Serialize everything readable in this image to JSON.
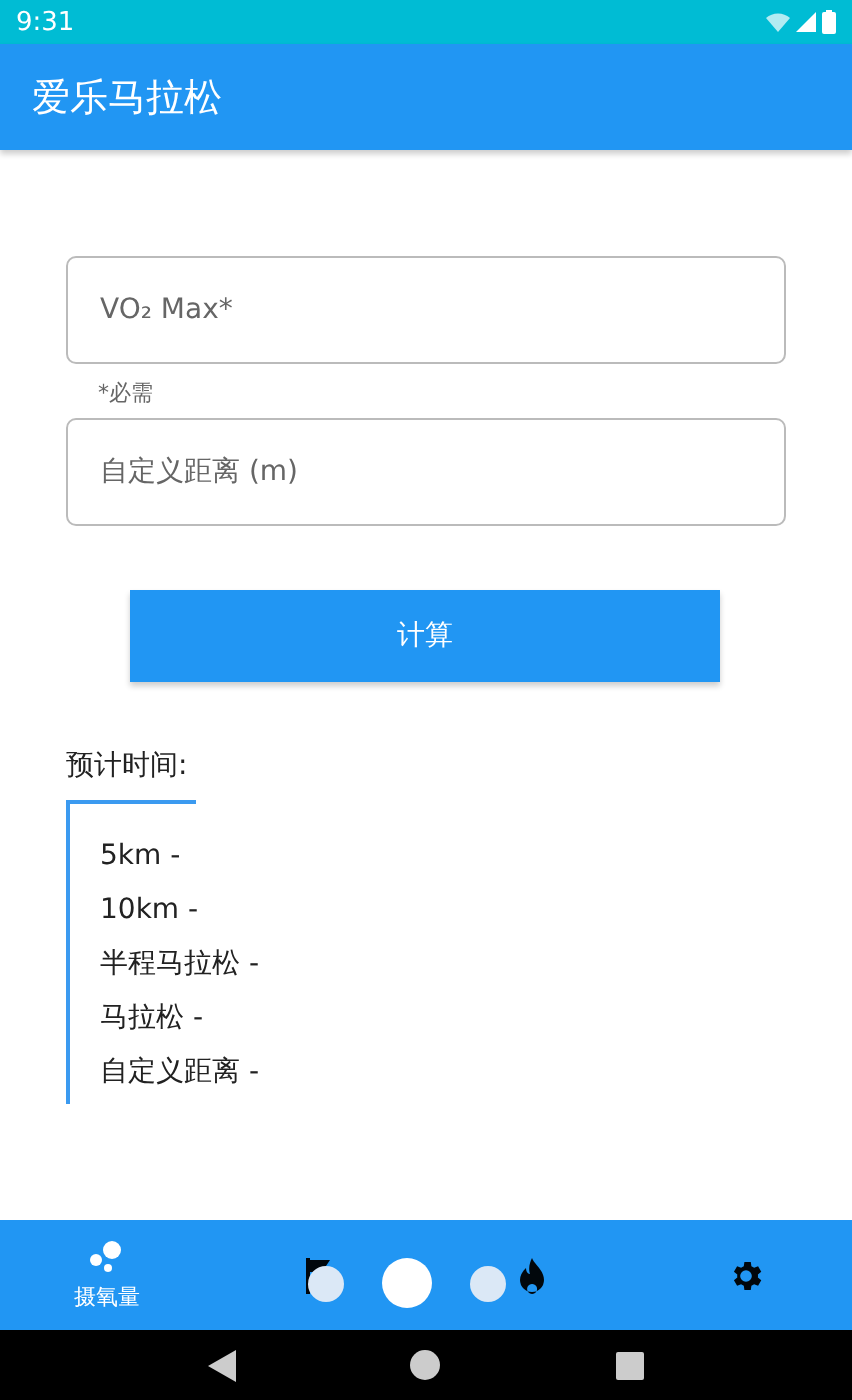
{
  "status_bar": {
    "time": "9:31"
  },
  "app_bar": {
    "title": "爱乐马拉松"
  },
  "form": {
    "fields": [
      {
        "placeholder": "VO₂ Max*",
        "helper": "*必需"
      },
      {
        "placeholder": "自定义距离 (m)"
      }
    ],
    "button": "计算"
  },
  "results": {
    "title": "预计时间:",
    "items": [
      "5km -",
      "10km -",
      "半程马拉松 -",
      "马拉松 -",
      "自定义距离 -"
    ]
  },
  "bottom_nav": [
    {
      "kind": "bubbles",
      "label": "摄氧量",
      "selected": true
    },
    {
      "kind": "flag",
      "selected": false
    },
    {
      "kind": "flame",
      "selected": false
    },
    {
      "kind": "settings",
      "selected": false
    }
  ],
  "pager_dots": [
    {
      "selected": false
    },
    {
      "selected": true
    },
    {
      "selected": false
    }
  ]
}
